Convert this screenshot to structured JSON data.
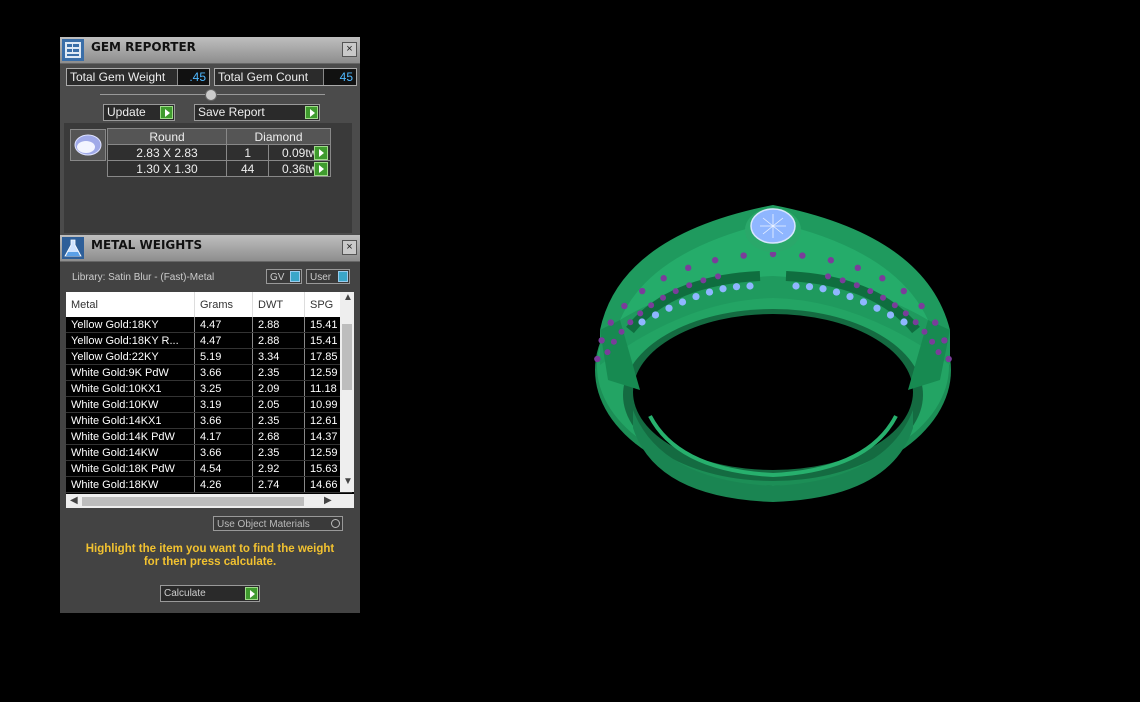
{
  "gem_reporter": {
    "title": "GEM REPORTER",
    "close_glyph": "×",
    "total_weight_label": "Total Gem Weight",
    "total_weight_value": ".45",
    "total_count_label": "Total Gem Count",
    "total_count_value": "45",
    "update_label": "Update",
    "save_report_label": "Save Report",
    "table": {
      "shape": "Round",
      "material": "Diamond",
      "rows": [
        {
          "size": "2.83 X 2.83",
          "count": "1",
          "weight": "0.09tw"
        },
        {
          "size": "1.30 X 1.30",
          "count": "44",
          "weight": "0.36tw"
        }
      ]
    }
  },
  "metal_weights": {
    "title": "METAL WEIGHTS",
    "close_glyph": "×",
    "library_text": "Library: Satin Blur - (Fast)-Metal",
    "gv_label": "GV",
    "user_label": "User",
    "columns": [
      "Metal",
      "Grams",
      "DWT",
      "SPG"
    ],
    "rows": [
      {
        "metal": "Yellow Gold:18KY",
        "grams": "4.47",
        "dwt": "2.88",
        "spg": "15.41"
      },
      {
        "metal": "Yellow Gold:18KY R...",
        "grams": "4.47",
        "dwt": "2.88",
        "spg": "15.41"
      },
      {
        "metal": "Yellow Gold:22KY",
        "grams": "5.19",
        "dwt": "3.34",
        "spg": "17.85"
      },
      {
        "metal": "White Gold:9K PdW",
        "grams": "3.66",
        "dwt": "2.35",
        "spg": "12.59"
      },
      {
        "metal": "White Gold:10KX1",
        "grams": "3.25",
        "dwt": "2.09",
        "spg": "11.18"
      },
      {
        "metal": "White Gold:10KW",
        "grams": "3.19",
        "dwt": "2.05",
        "spg": "10.99"
      },
      {
        "metal": "White Gold:14KX1",
        "grams": "3.66",
        "dwt": "2.35",
        "spg": "12.61"
      },
      {
        "metal": "White Gold:14K PdW",
        "grams": "4.17",
        "dwt": "2.68",
        "spg": "14.37"
      },
      {
        "metal": "White Gold:14KW",
        "grams": "3.66",
        "dwt": "2.35",
        "spg": "12.59"
      },
      {
        "metal": "White Gold:18K PdW",
        "grams": "4.54",
        "dwt": "2.92",
        "spg": "15.63"
      },
      {
        "metal": "White Gold:18KW",
        "grams": "4.26",
        "dwt": "2.74",
        "spg": "14.66"
      }
    ],
    "use_object_materials_label": "Use Object Materials",
    "hint_line1": "Highlight the item you want to find the weight",
    "hint_line2": "for then press calculate.",
    "calculate_label": "Calculate"
  },
  "colors": {
    "ring_green": "#1f9a5e",
    "gem_purple": "#7a3d9a",
    "gem_blue": "#8fb6ff",
    "hint_yellow": "#f2c230",
    "button_green": "#3f9b2e"
  }
}
